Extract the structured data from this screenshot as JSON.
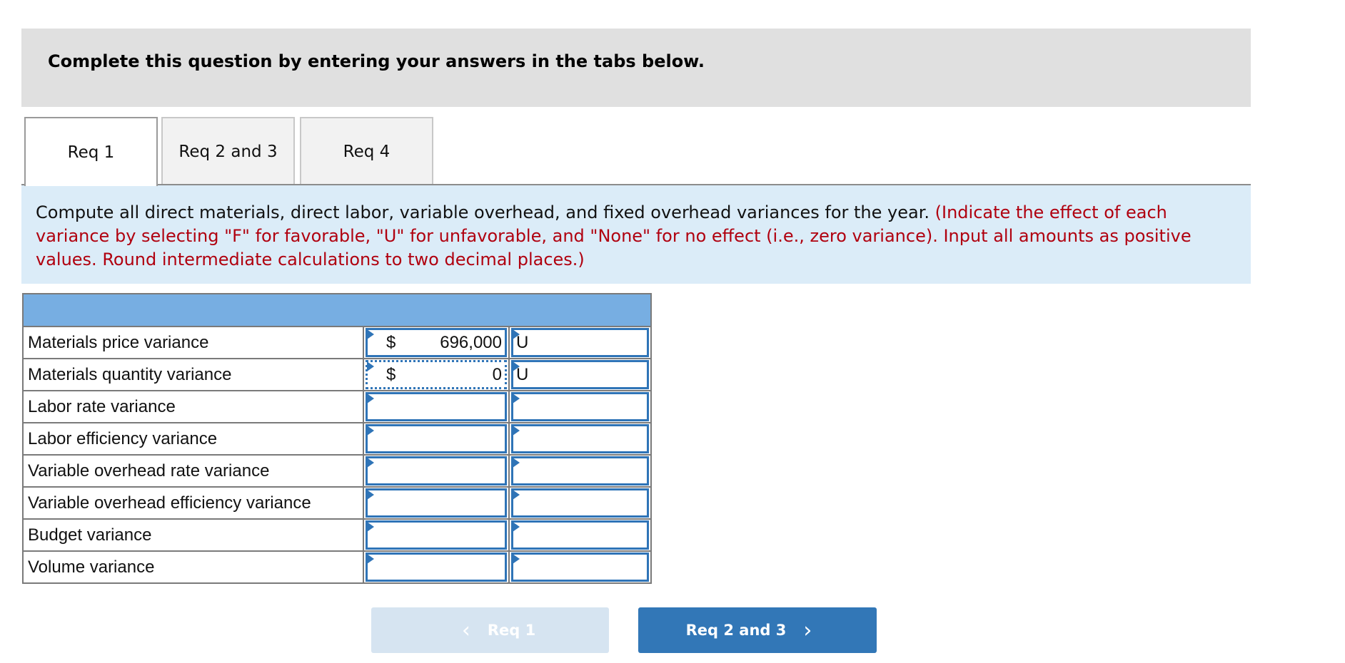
{
  "banner": {
    "title": "Complete this question by entering your answers in the tabs below."
  },
  "tabs": [
    {
      "label": "Req 1",
      "active": true
    },
    {
      "label": "Req 2 and 3",
      "active": false
    },
    {
      "label": "Req 4",
      "active": false
    }
  ],
  "prompt": {
    "text": "Compute all direct materials, direct labor, variable overhead, and fixed overhead variances for the year. ",
    "note": "(Indicate the effect of each variance by selecting \"F\" for favorable, \"U\" for unfavorable, and \"None\" for no effect (i.e., zero variance). Input all amounts as positive values. Round intermediate calculations to two decimal places.)"
  },
  "table": {
    "rows": [
      {
        "label": "Materials price variance",
        "currency": "$",
        "amount": "696,000",
        "effect": "U"
      },
      {
        "label": "Materials quantity variance",
        "currency": "$",
        "amount": "0",
        "effect": "U",
        "focused": true
      },
      {
        "label": "Labor rate variance",
        "currency": "",
        "amount": "",
        "effect": ""
      },
      {
        "label": "Labor efficiency variance",
        "currency": "",
        "amount": "",
        "effect": ""
      },
      {
        "label": "Variable overhead rate variance",
        "currency": "",
        "amount": "",
        "effect": ""
      },
      {
        "label": "Variable overhead efficiency variance",
        "currency": "",
        "amount": "",
        "effect": ""
      },
      {
        "label": "Budget variance",
        "currency": "",
        "amount": "",
        "effect": ""
      },
      {
        "label": "Volume variance",
        "currency": "",
        "amount": "",
        "effect": ""
      }
    ]
  },
  "nav": {
    "prev_label": "Req 1",
    "prev_icon": "chevron-left-icon",
    "prev_glyph": "‹",
    "next_label": "Req 2 and 3",
    "next_icon": "chevron-right-icon",
    "next_glyph": "›"
  },
  "colors": {
    "header_blue": "#77aee2",
    "input_border": "#2f74b7",
    "note_red": "#b0000f",
    "next_button": "#3277b7",
    "prev_button_disabled": "#d6e4f1"
  }
}
